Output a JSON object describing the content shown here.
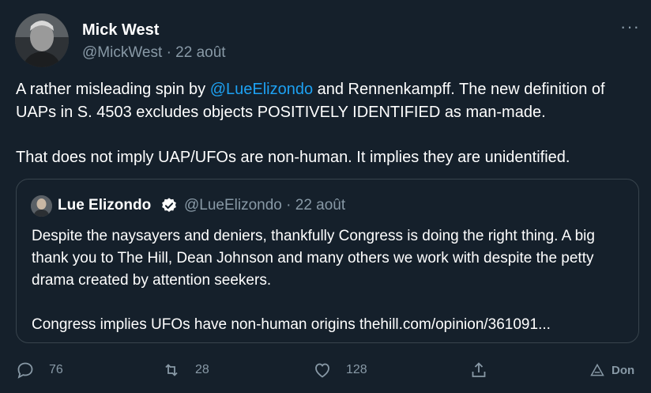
{
  "tweet": {
    "author_name": "Mick West",
    "author_handle": "@MickWest",
    "date": "· 22 août",
    "more_label": "···",
    "text_part1": "A rather misleading spin by ",
    "mention": "@LueElizondo",
    "text_part2": " and Rennenkampff.  The new definition of UAPs in S. 4503 excludes objects POSITIVELY IDENTIFIED as man-made.",
    "text_paragraph2": "That does not imply UAP/UFOs are non-human. It implies they are unidentified."
  },
  "quoted_tweet": {
    "author_name": "Lue Elizondo",
    "verified_icon": "verified-badge-icon",
    "author_handle": "@LueElizondo",
    "date": "· 22 août",
    "paragraph1": "Despite the naysayers and deniers, thankfully Congress is doing the right thing. A big thank you to The Hill, Dean Johnson and many others we work with despite the petty drama created by attention seekers.",
    "paragraph2": "Congress implies UFOs have non-human origins thehill.com/opinion/361091..."
  },
  "actions": {
    "reply_count": "76",
    "retweet_count": "28",
    "like_count": "128",
    "donate_label": "Don"
  },
  "colors": {
    "background": "#15202b",
    "text_primary": "#ffffff",
    "text_secondary": "#8899a6",
    "link": "#1da1f2",
    "border": "#38444d"
  }
}
